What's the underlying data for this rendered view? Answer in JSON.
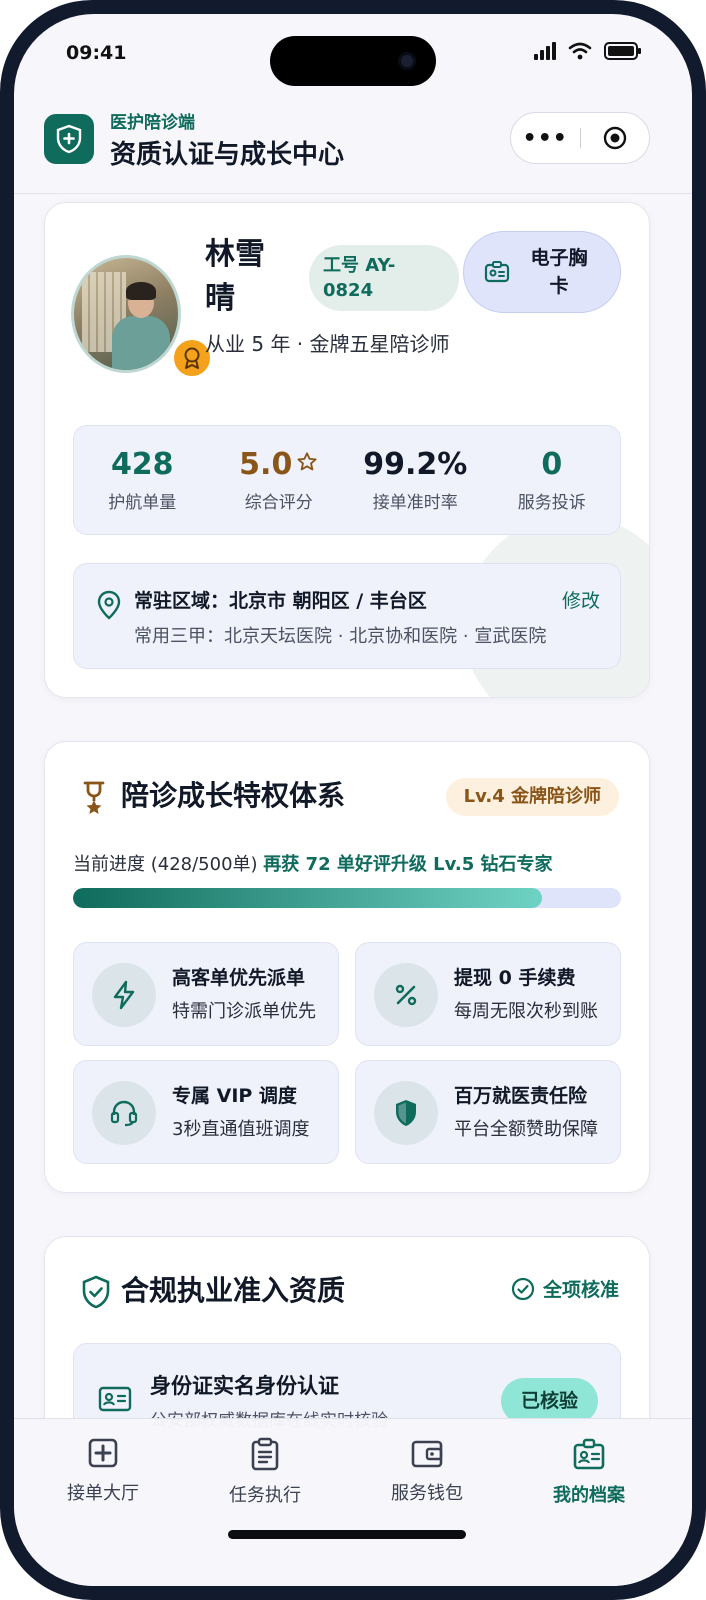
{
  "status_bar": {
    "time": "09:41"
  },
  "header": {
    "app_name": "医护陪诊端",
    "title": "资质认证与成长中心"
  },
  "profile": {
    "name": "林雪晴",
    "employee_id": "工号 AY-0824",
    "badge_button": "电子胸卡",
    "title_line": "从业 5 年 · 金牌五星陪诊师",
    "stats": [
      {
        "value": "428",
        "label": "护航单量"
      },
      {
        "value": "5.0",
        "label": "综合评分"
      },
      {
        "value": "99.2%",
        "label": "接单准时率"
      },
      {
        "value": "0",
        "label": "服务投诉"
      }
    ],
    "region": {
      "primary": "常驻区域：北京市 朝阳区 / 丰台区",
      "hospitals": "常用三甲：北京天坛医院 · 北京协和医院 · 宣武医院",
      "edit_label": "修改"
    }
  },
  "growth": {
    "title": "陪诊成长特权体系",
    "level": "Lv.4 金牌陪诊师",
    "progress_label": "当前进度 (428/500单)",
    "progress_hint": "再获 72 单好评升级 Lv.5 钻石专家",
    "progress_fraction": 0.856,
    "perks": [
      {
        "title": "高客单优先派单",
        "desc": "特需门诊派单优先",
        "icon": "lightning-icon"
      },
      {
        "title": "提现 0 手续费",
        "desc": "每周无限次秒到账",
        "icon": "percent-icon"
      },
      {
        "title": "专属 VIP 调度",
        "desc": "3秒直通值班调度",
        "icon": "headset-icon"
      },
      {
        "title": "百万就医责任险",
        "desc": "平台全额赞助保障",
        "icon": "shield-icon"
      }
    ]
  },
  "compliance": {
    "title": "合规执业准入资质",
    "status": "全项核准",
    "items": [
      {
        "title": "身份证实名身份认证",
        "desc": "公安部权威数据库在线实时核验",
        "status": "已核验"
      }
    ]
  },
  "tabbar": {
    "tabs": [
      {
        "label": "接单大厅",
        "icon": "plus-square-icon"
      },
      {
        "label": "任务执行",
        "icon": "clipboard-icon"
      },
      {
        "label": "服务钱包",
        "icon": "wallet-icon"
      },
      {
        "label": "我的档案",
        "icon": "id-badge-icon"
      }
    ],
    "active_index": 3
  },
  "colors": {
    "brand": "#0f6b5c",
    "gold": "#8a5518",
    "medal": "#f4a21b",
    "page_bg": "#f6f6fb"
  }
}
